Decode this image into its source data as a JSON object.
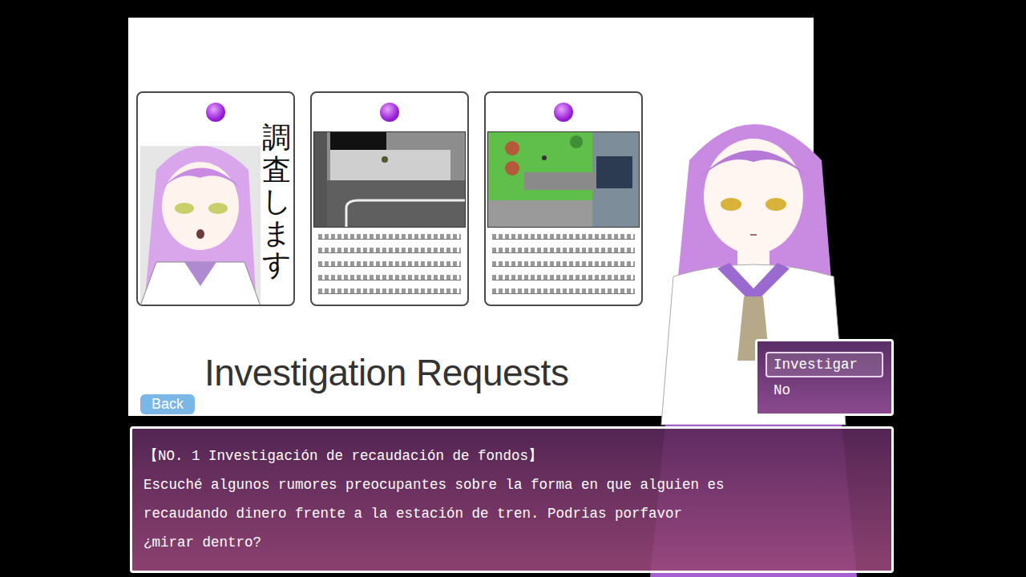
{
  "panel": {
    "heading": "Investigation Requests",
    "back_button": "Back"
  },
  "cards": [
    {
      "kind": "portrait",
      "caption": "調査します"
    },
    {
      "kind": "street",
      "caption": ""
    },
    {
      "kind": "park",
      "caption": ""
    }
  ],
  "choices": [
    {
      "label": "Investigar",
      "selected": true
    },
    {
      "label": "No",
      "selected": false
    }
  ],
  "message": {
    "title": "【NO. 1 Investigación de recaudación de fondos】",
    "lines": [
      "Escuché algunos rumores preocupantes sobre la forma en que alguien es",
      "recaudando dinero frente a la estación de tren. Podrias porfavor",
      "¿mirar dentro?"
    ]
  }
}
